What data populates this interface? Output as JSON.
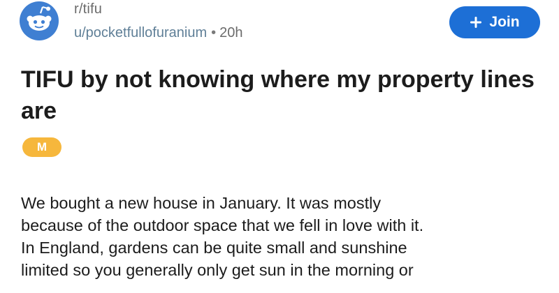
{
  "post": {
    "subreddit": "r/tifu",
    "author": "u/pocketfullofuranium",
    "separator": "•",
    "age": "20h",
    "join_label": "Join",
    "title": "TIFU by not knowing where my property lines are",
    "flair": "M",
    "body_lines": [
      "We bought a new house in January. It was mostly",
      "because of the outdoor space that we fell in love with it.",
      "In England, gardens can be quite small and sunshine",
      "limited so you generally only get sun in the morning or"
    ]
  },
  "icons": {
    "subreddit_avatar": "reddit-snoo-icon",
    "join": "plus-icon"
  },
  "colors": {
    "join_button": "#1d6fd6",
    "avatar": "#3f7fd2",
    "flair": "#f6b73c",
    "meta_text": "#6b6b6b",
    "author_text": "#5f7f97"
  }
}
